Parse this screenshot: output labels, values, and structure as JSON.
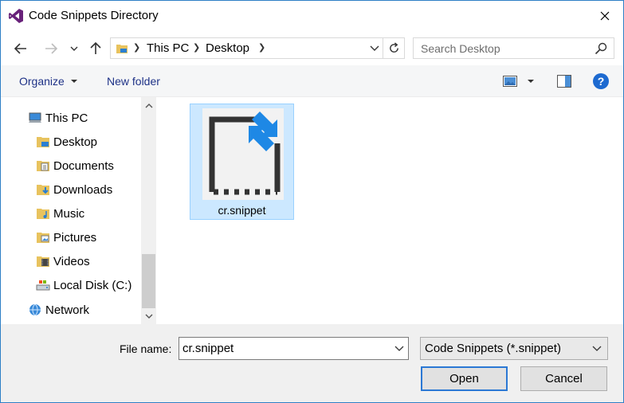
{
  "window": {
    "title": "Code Snippets Directory",
    "accent_color": "#2d7fc6",
    "icons": {
      "app": "visual-studio-icon",
      "close": "close-icon"
    }
  },
  "navigation": {
    "back": "back-arrow-icon",
    "forward": "forward-arrow-icon",
    "recent": "chevron-down-icon",
    "up": "up-arrow-icon",
    "breadcrumb": [
      "This PC",
      "Desktop"
    ],
    "search_placeholder": "Search Desktop"
  },
  "toolbar": {
    "organize_label": "Organize",
    "new_folder_label": "New folder",
    "help_label": "?"
  },
  "nav_pane": {
    "items": [
      {
        "label": "This PC",
        "icon": "computer-icon"
      },
      {
        "label": "Desktop",
        "icon": "desktop-folder-icon"
      },
      {
        "label": "Documents",
        "icon": "documents-folder-icon"
      },
      {
        "label": "Downloads",
        "icon": "downloads-folder-icon"
      },
      {
        "label": "Music",
        "icon": "music-folder-icon"
      },
      {
        "label": "Pictures",
        "icon": "pictures-folder-icon"
      },
      {
        "label": "Videos",
        "icon": "videos-folder-icon"
      },
      {
        "label": "Local Disk (C:)",
        "icon": "local-disk-icon"
      },
      {
        "label": "Network",
        "icon": "network-icon"
      }
    ]
  },
  "files": [
    {
      "name": "cr.snippet",
      "selected": true,
      "icon": "snippet-file-icon"
    }
  ],
  "footer": {
    "file_name_label": "File name:",
    "file_name_value": "cr.snippet",
    "file_type_value": "Code Snippets (*.snippet)",
    "open_label": "Open",
    "cancel_label": "Cancel"
  }
}
